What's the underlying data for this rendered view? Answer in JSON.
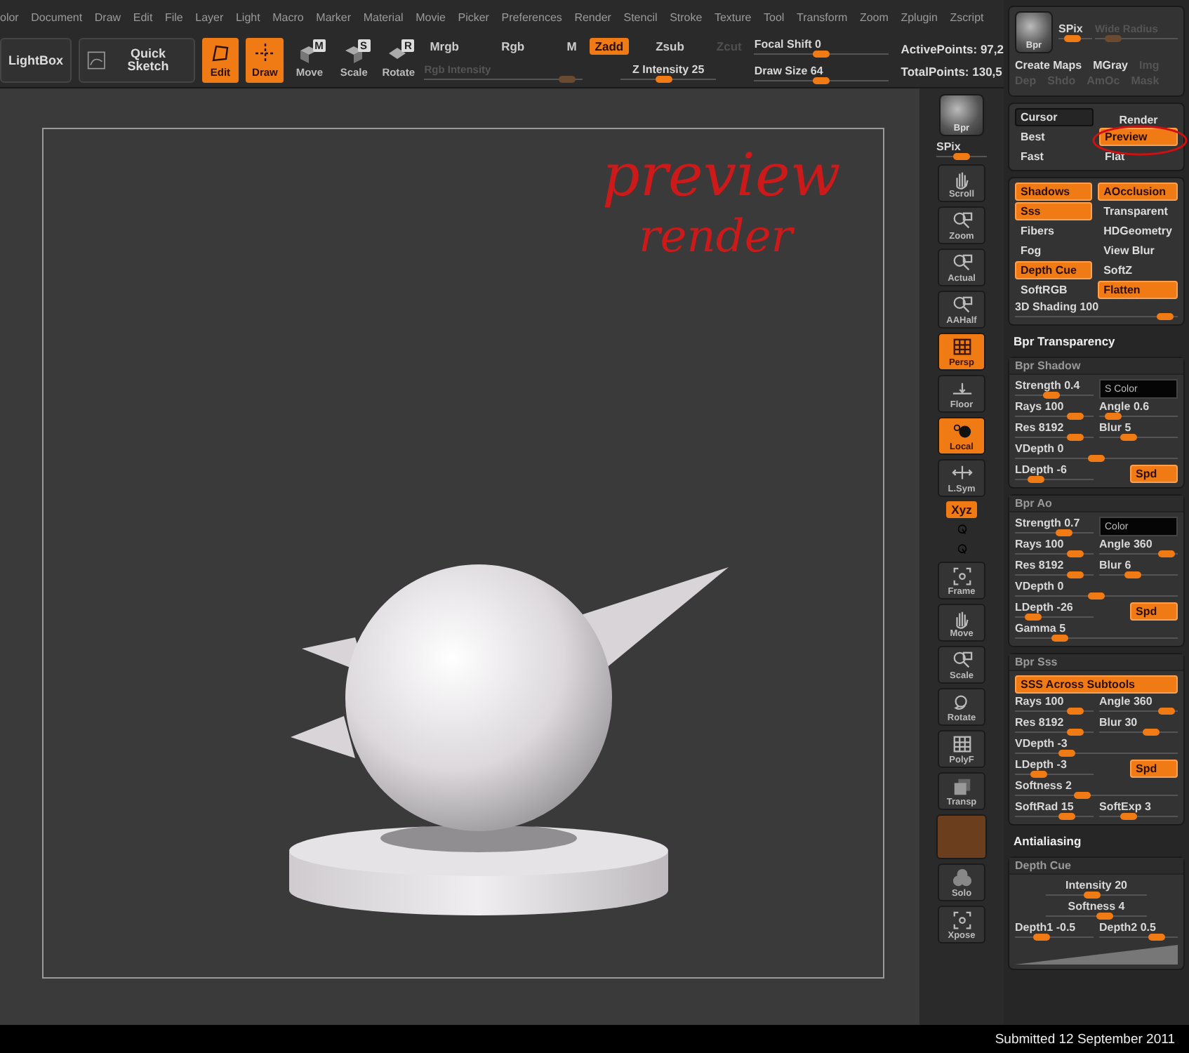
{
  "menu": [
    "olor",
    "Document",
    "Draw",
    "Edit",
    "File",
    "Layer",
    "Light",
    "Macro",
    "Marker",
    "Material",
    "Movie",
    "Picker",
    "Preferences",
    "Render",
    "Stencil",
    "Stroke",
    "Texture",
    "Tool",
    "Transform",
    "Zoom",
    "Zplugin",
    "Zscript"
  ],
  "toolbar": {
    "lightbox": "LightBox",
    "quick_sketch": "Quick Sketch",
    "modes": [
      {
        "label": "Edit",
        "kind": "edit",
        "selected": true
      },
      {
        "label": "Draw",
        "kind": "draw",
        "selected": true
      },
      {
        "label": "Move",
        "kind": "move",
        "key": "M",
        "selected": false
      },
      {
        "label": "Scale",
        "kind": "scale",
        "key": "S",
        "selected": false
      },
      {
        "label": "Rotate",
        "kind": "rotate",
        "key": "R",
        "selected": false
      }
    ],
    "color_modes": [
      {
        "label": "Mrgb",
        "selected": false
      },
      {
        "label": "Rgb",
        "selected": false
      },
      {
        "label": "M",
        "selected": false
      }
    ],
    "rgb_intensity": {
      "label": "Rgb Intensity",
      "disabled": true,
      "level": 0.95
    },
    "z_modes": [
      {
        "label": "Zadd",
        "selected": true,
        "disabled": false
      },
      {
        "label": "Zsub",
        "selected": false,
        "disabled": false
      },
      {
        "label": "Zcut",
        "selected": false,
        "disabled": true
      }
    ],
    "z_intensity": {
      "label": "Z Intensity 25",
      "level": 0.45
    },
    "focal_shift": {
      "label": "Focal Shift 0",
      "level": 0.5
    },
    "draw_size": {
      "label": "Draw Size 64",
      "level": 0.5
    },
    "active_points": "ActivePoints: 97,2",
    "total_points": "TotalPoints: 130,5"
  },
  "canvas": {
    "annotation": [
      "preview",
      "render"
    ]
  },
  "side_tools": [
    {
      "label": "Bpr",
      "kind": "sphere",
      "selected": false
    },
    {
      "label": "SPix",
      "kind": "slider",
      "level": 0.5
    },
    {
      "label": "Scroll",
      "kind": "hand",
      "selected": false
    },
    {
      "label": "Zoom",
      "kind": "magnifier",
      "selected": false
    },
    {
      "label": "Actual",
      "kind": "magnifier",
      "selected": false
    },
    {
      "label": "AAHalf",
      "kind": "magnifier",
      "selected": false
    },
    {
      "label": "Persp",
      "kind": "grid",
      "selected": true
    },
    {
      "label": "Floor",
      "kind": "floor",
      "selected": false
    },
    {
      "label": "Local",
      "kind": "pivot",
      "selected": true
    },
    {
      "label": "L.Sym",
      "kind": "sym",
      "selected": false
    },
    {
      "label": "Xyz",
      "kind": "axis",
      "selected": true
    },
    {
      "kind": "mini"
    },
    {
      "kind": "mini"
    },
    {
      "label": "Frame",
      "kind": "frame",
      "selected": false
    },
    {
      "label": "Move",
      "kind": "hand",
      "selected": false
    },
    {
      "label": "Scale",
      "kind": "magnifier",
      "selected": false
    },
    {
      "label": "Rotate",
      "kind": "orbit",
      "selected": false
    },
    {
      "label": "PolyF",
      "kind": "grid",
      "selected": false
    },
    {
      "label": "Transp",
      "kind": "layers",
      "selected": false
    },
    {
      "kind": "swatch"
    },
    {
      "label": "Solo",
      "kind": "cloud",
      "selected": false
    },
    {
      "label": "Xpose",
      "kind": "frame",
      "selected": false
    }
  ],
  "bpr_panel": {
    "button": "Bpr",
    "spix": {
      "label": "SPix",
      "level": 0.3
    },
    "radius": {
      "label": "Wide Radius",
      "disabled": true,
      "level": 0.15
    },
    "items": [
      {
        "label": "Create Maps",
        "disabled": false
      },
      {
        "label": "MGray",
        "disabled": false
      },
      {
        "label": "Img",
        "disabled": true
      },
      {
        "label": "Dep",
        "disabled": true
      },
      {
        "label": "Shdo",
        "disabled": true
      },
      {
        "label": "AmOc",
        "disabled": true
      },
      {
        "label": "Mask",
        "disabled": true
      }
    ]
  },
  "render_panel": {
    "cursor": "Cursor",
    "render": "Render",
    "modes": [
      {
        "label": "Best",
        "selected": false
      },
      {
        "label": "Preview",
        "selected": true
      },
      {
        "label": "Fast",
        "selected": false
      },
      {
        "label": "Flat",
        "selected": false
      }
    ]
  },
  "render_options": {
    "toggles": [
      {
        "label": "Shadows",
        "on": true
      },
      {
        "label": "AOcclusion",
        "on": true
      },
      {
        "label": "Sss",
        "on": true
      },
      {
        "label": "Transparent",
        "on": false
      },
      {
        "label": "Fibers",
        "on": false
      },
      {
        "label": "HDGeometry",
        "on": false
      },
      {
        "label": "Fog",
        "on": false
      },
      {
        "label": "View Blur",
        "on": false
      },
      {
        "label": "Depth Cue",
        "on": true
      },
      {
        "label": "SoftZ",
        "on": false
      },
      {
        "label": "SoftRGB",
        "on": false
      },
      {
        "label": "Flatten",
        "on": true
      }
    ],
    "shading": {
      "label": "3D Shading 100",
      "level": 0.97
    }
  },
  "panels": [
    {
      "kind": "heading",
      "title": "Bpr Transparency"
    },
    {
      "kind": "section",
      "title": "Bpr Shadow",
      "rows": [
        [
          {
            "kind": "slider",
            "label": "Strength 0.4",
            "level": 0.45
          },
          {
            "kind": "swatch",
            "label": "S Color"
          }
        ],
        [
          {
            "kind": "slider",
            "label": "Rays 100",
            "level": 0.85
          },
          {
            "kind": "slider",
            "label": "Angle 0.6",
            "level": 0.1
          }
        ],
        [
          {
            "kind": "slider",
            "label": "Res 8192",
            "level": 0.85
          },
          {
            "kind": "slider",
            "label": "Blur 5",
            "level": 0.35
          }
        ],
        [
          {
            "kind": "slider",
            "label": "VDepth 0",
            "level": 0.5
          }
        ],
        [
          {
            "kind": "slider",
            "label": "LDepth -6",
            "level": 0.2
          },
          {
            "kind": "toggle",
            "label": "Spd",
            "on": true
          }
        ]
      ]
    },
    {
      "kind": "section",
      "title": "Bpr Ao",
      "rows": [
        [
          {
            "kind": "slider",
            "label": "Strength 0.7",
            "level": 0.65
          },
          {
            "kind": "swatch",
            "label": "Color"
          }
        ],
        [
          {
            "kind": "slider",
            "label": "Rays 100",
            "level": 0.85
          },
          {
            "kind": "slider",
            "label": "Angle 360",
            "level": 0.95
          }
        ],
        [
          {
            "kind": "slider",
            "label": "Res 8192",
            "level": 0.85
          },
          {
            "kind": "slider",
            "label": "Blur 6",
            "level": 0.4
          }
        ],
        [
          {
            "kind": "slider",
            "label": "VDepth 0",
            "level": 0.5
          }
        ],
        [
          {
            "kind": "slider",
            "label": "LDepth -26",
            "level": 0.15
          },
          {
            "kind": "toggle",
            "label": "Spd",
            "on": true
          }
        ],
        [
          {
            "kind": "slider",
            "label": "Gamma 5",
            "level": 0.25
          }
        ]
      ]
    },
    {
      "kind": "section",
      "title": "Bpr Sss",
      "rows": [
        [
          {
            "kind": "toggle",
            "label": "SSS Across Subtools",
            "on": true
          }
        ],
        [
          {
            "kind": "slider",
            "label": "Rays 100",
            "level": 0.85
          },
          {
            "kind": "slider",
            "label": "Angle 360",
            "level": 0.95
          }
        ],
        [
          {
            "kind": "slider",
            "label": "Res 8192",
            "level": 0.85
          },
          {
            "kind": "slider",
            "label": "Blur 30",
            "level": 0.7
          }
        ],
        [
          {
            "kind": "slider",
            "label": "VDepth -3",
            "level": 0.3
          }
        ],
        [
          {
            "kind": "slider",
            "label": "LDepth -3",
            "level": 0.25
          },
          {
            "kind": "toggle",
            "label": "Spd",
            "on": true
          }
        ],
        [
          {
            "kind": "slider",
            "label": "Softness 2",
            "level": 0.4
          }
        ],
        [
          {
            "kind": "slider",
            "label": "SoftRad 15",
            "level": 0.7
          },
          {
            "kind": "slider",
            "label": "SoftExp 3",
            "level": 0.35
          }
        ]
      ]
    },
    {
      "kind": "heading",
      "title": "Antialiasing"
    },
    {
      "kind": "section",
      "title": "Depth Cue",
      "rows": [
        [
          {
            "kind": "center-slider",
            "label": "Intensity 20",
            "level": 0.45
          }
        ],
        [
          {
            "kind": "center-slider",
            "label": "Softness 4",
            "level": 0.6
          }
        ],
        [
          {
            "kind": "slider",
            "label": "Depth1 -0.5",
            "level": 0.3
          },
          {
            "kind": "slider",
            "label": "Depth2 0.5",
            "level": 0.8
          }
        ],
        [
          {
            "kind": "curve"
          }
        ]
      ]
    }
  ],
  "footer": "Submitted 12 September 2011"
}
